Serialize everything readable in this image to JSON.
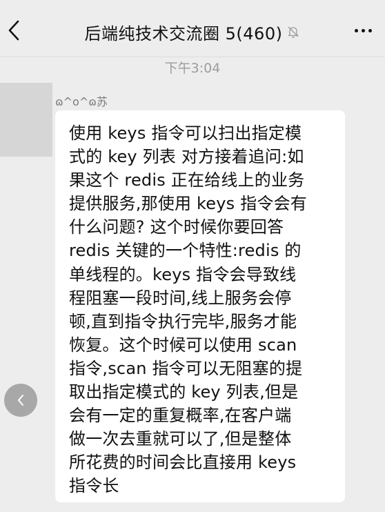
{
  "header": {
    "title": "后端纯技术交流圈 5(460)",
    "back_icon": "chevron-left-icon",
    "mute_icon": "bell-off-icon",
    "more_icon": "more-horizontal-icon"
  },
  "chat": {
    "timestamp": "下午3:04",
    "message": {
      "sender": "ɷ^o^ɷ苏",
      "lines": [
        "使用 keys 指令可以扫出指定模",
        "式的 key 列表 对方接着追问:如",
        "果这个 redis 正在给线上的业务",
        "提供服务,那使用 keys 指令会有",
        "什么问题? 这个时候你要回答",
        "redis 关键的一个特性:redis 的",
        "单线程的。keys 指令会导致线",
        "程阻塞一段时间,线上服务会停",
        "顿,直到指令执行完毕,服务才能",
        "恢复。这个时候可以使用 scan",
        "指令,scan 指令可以无阻塞的提",
        "取出指定模式的 key 列表,但是",
        "会有一定的重复概率,在客户端",
        "做一次去重就可以了,但是整体",
        "所花费的时间会比直接用 keys",
        "指令长"
      ]
    }
  },
  "floating_back": {
    "icon": "chevron-left-icon"
  },
  "colors": {
    "background": "#ededed",
    "bubble": "#ffffff",
    "avatar_placeholder": "#d6d6d6",
    "timestamp": "#9c9c9c"
  }
}
